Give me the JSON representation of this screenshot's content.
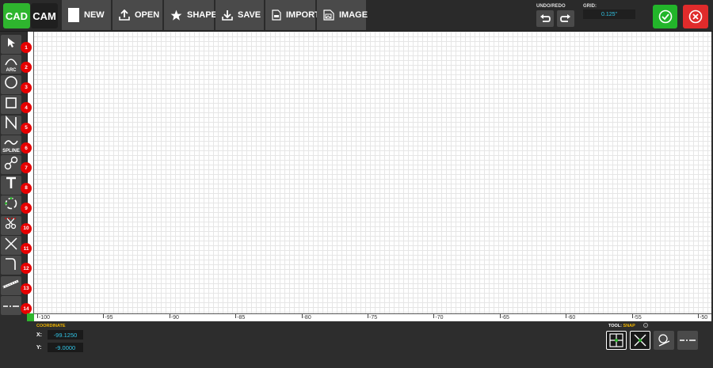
{
  "modes": {
    "cad": "CAD",
    "cam": "CAM"
  },
  "toolbar": {
    "new": "NEW",
    "open": "OPEN",
    "shapes": "SHAPES",
    "save": "SAVE",
    "import": "IMPORT",
    "image": "IMAGE"
  },
  "undo_redo": {
    "label": "UNDO/REDO"
  },
  "grid": {
    "label": "GRID:",
    "value": "0.125\""
  },
  "tools": [
    {
      "num": "1",
      "icon": "pointer-icon",
      "label": ""
    },
    {
      "num": "2",
      "icon": "arc-icon",
      "label": "ARC"
    },
    {
      "num": "3",
      "icon": "circle-icon",
      "label": ""
    },
    {
      "num": "4",
      "icon": "rectangle-icon",
      "label": ""
    },
    {
      "num": "5",
      "icon": "polyline-icon",
      "label": ""
    },
    {
      "num": "6",
      "icon": "spline-icon",
      "label": "SPLINE"
    },
    {
      "num": "7",
      "icon": "fillet-icon",
      "label": ""
    },
    {
      "num": "8",
      "icon": "text-icon",
      "label": ""
    },
    {
      "num": "9",
      "icon": "offset-icon",
      "label": ""
    },
    {
      "num": "10",
      "icon": "trim-icon",
      "label": ""
    },
    {
      "num": "11",
      "icon": "extend-icon",
      "label": ""
    },
    {
      "num": "12",
      "icon": "corner-icon",
      "label": ""
    },
    {
      "num": "13",
      "icon": "measure-icon",
      "label": ""
    },
    {
      "num": "14",
      "icon": "construction-line-icon",
      "label": ""
    }
  ],
  "ruler": {
    "x_ticks": [
      "-100",
      "-95",
      "-90",
      "-85",
      "-80",
      "-75",
      "-70",
      "-65",
      "-60",
      "-55",
      "-50"
    ]
  },
  "status": {
    "coordinate_label": "COORDINATE",
    "x_label": "X:",
    "x_value": "-99.1250",
    "y_label": "Y:",
    "y_value": "-9.0000",
    "tool_label": "TOOL:",
    "tool_value": "SNAP"
  },
  "colors": {
    "cad_active": "#2eb52e",
    "confirm": "#22b52a",
    "cancel": "#e02b2b",
    "badge": "#e60000",
    "value_text": "#31c4e6",
    "label_accent": "#f0b400"
  }
}
